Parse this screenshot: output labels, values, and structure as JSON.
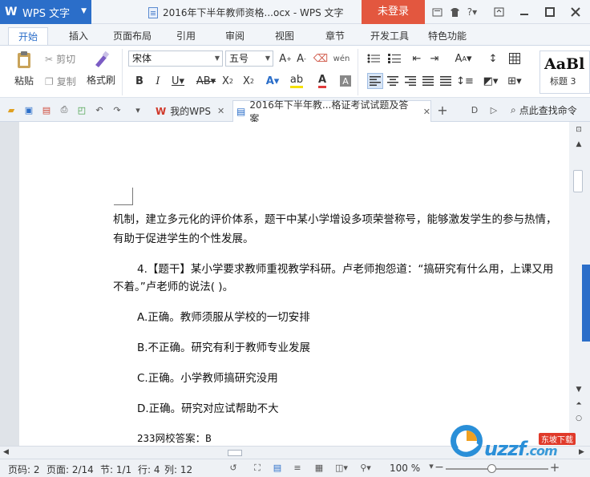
{
  "app": {
    "name": "WPS 文字",
    "logo_letter": "W"
  },
  "window": {
    "title": "2016年下半年教师资格...ocx - WPS 文字",
    "login_label": "未登录"
  },
  "menu": {
    "tabs": [
      "开始",
      "插入",
      "页面布局",
      "引用",
      "审阅",
      "视图",
      "章节",
      "开发工具",
      "特色功能"
    ],
    "active_tab": "开始"
  },
  "ribbon": {
    "paste_label": "粘贴",
    "cut_label": "剪切",
    "copy_label": "复制",
    "format_painter_label": "格式刷",
    "font_name": "宋体",
    "font_size": "五号",
    "style_preview": "AaBl",
    "style_name": "标题 3"
  },
  "quick_bar": {
    "tabs": [
      {
        "label": "我的WPS"
      },
      {
        "label": "2016年下半年教...格证考试试题及答案"
      }
    ],
    "new_tab_label": "+",
    "search_command": "点此查找命令"
  },
  "document": {
    "paragraphs": [
      "机制，建立多元化的评价体系，题干中某小学增设多项荣誉称号，能够激发学生的参与热情，",
      "有助于促进学生的个性发展。",
      "4.【题干】某小学要求教师重视教学科研。卢老师抱怨道：“搞研究有什么用，上课又用",
      "不着。”卢老师的说法(     )。",
      "A.正确。教师须服从学校的一切安排",
      "B.不正确。研究有利于教师专业发展",
      "C.正确。小学教师搞研究没用",
      "D.正确。研究对应试帮助不大",
      "233网校答案：B"
    ]
  },
  "status": {
    "page_code": "页码: 2",
    "page": "页面: 2/14",
    "section": "节: 1/1",
    "row": "行: 4",
    "column": "列: 12",
    "zoom": "100 %"
  },
  "watermark": {
    "text": "uzzf",
    "sub": ".com",
    "tag": "东坡下载"
  },
  "colors": {
    "accent": "#2b6ec9",
    "login": "#e3573f"
  }
}
